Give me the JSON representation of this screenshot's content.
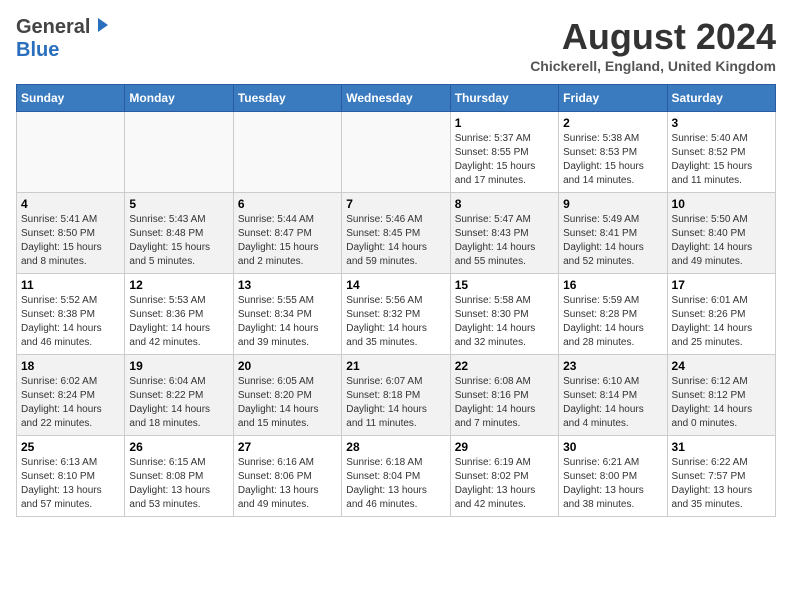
{
  "header": {
    "logo_general": "General",
    "logo_blue": "Blue",
    "month_year": "August 2024",
    "location": "Chickerell, England, United Kingdom"
  },
  "weekdays": [
    "Sunday",
    "Monday",
    "Tuesday",
    "Wednesday",
    "Thursday",
    "Friday",
    "Saturday"
  ],
  "weeks": [
    [
      {
        "day": "",
        "info": ""
      },
      {
        "day": "",
        "info": ""
      },
      {
        "day": "",
        "info": ""
      },
      {
        "day": "",
        "info": ""
      },
      {
        "day": "1",
        "info": "Sunrise: 5:37 AM\nSunset: 8:55 PM\nDaylight: 15 hours\nand 17 minutes."
      },
      {
        "day": "2",
        "info": "Sunrise: 5:38 AM\nSunset: 8:53 PM\nDaylight: 15 hours\nand 14 minutes."
      },
      {
        "day": "3",
        "info": "Sunrise: 5:40 AM\nSunset: 8:52 PM\nDaylight: 15 hours\nand 11 minutes."
      }
    ],
    [
      {
        "day": "4",
        "info": "Sunrise: 5:41 AM\nSunset: 8:50 PM\nDaylight: 15 hours\nand 8 minutes."
      },
      {
        "day": "5",
        "info": "Sunrise: 5:43 AM\nSunset: 8:48 PM\nDaylight: 15 hours\nand 5 minutes."
      },
      {
        "day": "6",
        "info": "Sunrise: 5:44 AM\nSunset: 8:47 PM\nDaylight: 15 hours\nand 2 minutes."
      },
      {
        "day": "7",
        "info": "Sunrise: 5:46 AM\nSunset: 8:45 PM\nDaylight: 14 hours\nand 59 minutes."
      },
      {
        "day": "8",
        "info": "Sunrise: 5:47 AM\nSunset: 8:43 PM\nDaylight: 14 hours\nand 55 minutes."
      },
      {
        "day": "9",
        "info": "Sunrise: 5:49 AM\nSunset: 8:41 PM\nDaylight: 14 hours\nand 52 minutes."
      },
      {
        "day": "10",
        "info": "Sunrise: 5:50 AM\nSunset: 8:40 PM\nDaylight: 14 hours\nand 49 minutes."
      }
    ],
    [
      {
        "day": "11",
        "info": "Sunrise: 5:52 AM\nSunset: 8:38 PM\nDaylight: 14 hours\nand 46 minutes."
      },
      {
        "day": "12",
        "info": "Sunrise: 5:53 AM\nSunset: 8:36 PM\nDaylight: 14 hours\nand 42 minutes."
      },
      {
        "day": "13",
        "info": "Sunrise: 5:55 AM\nSunset: 8:34 PM\nDaylight: 14 hours\nand 39 minutes."
      },
      {
        "day": "14",
        "info": "Sunrise: 5:56 AM\nSunset: 8:32 PM\nDaylight: 14 hours\nand 35 minutes."
      },
      {
        "day": "15",
        "info": "Sunrise: 5:58 AM\nSunset: 8:30 PM\nDaylight: 14 hours\nand 32 minutes."
      },
      {
        "day": "16",
        "info": "Sunrise: 5:59 AM\nSunset: 8:28 PM\nDaylight: 14 hours\nand 28 minutes."
      },
      {
        "day": "17",
        "info": "Sunrise: 6:01 AM\nSunset: 8:26 PM\nDaylight: 14 hours\nand 25 minutes."
      }
    ],
    [
      {
        "day": "18",
        "info": "Sunrise: 6:02 AM\nSunset: 8:24 PM\nDaylight: 14 hours\nand 22 minutes."
      },
      {
        "day": "19",
        "info": "Sunrise: 6:04 AM\nSunset: 8:22 PM\nDaylight: 14 hours\nand 18 minutes."
      },
      {
        "day": "20",
        "info": "Sunrise: 6:05 AM\nSunset: 8:20 PM\nDaylight: 14 hours\nand 15 minutes."
      },
      {
        "day": "21",
        "info": "Sunrise: 6:07 AM\nSunset: 8:18 PM\nDaylight: 14 hours\nand 11 minutes."
      },
      {
        "day": "22",
        "info": "Sunrise: 6:08 AM\nSunset: 8:16 PM\nDaylight: 14 hours\nand 7 minutes."
      },
      {
        "day": "23",
        "info": "Sunrise: 6:10 AM\nSunset: 8:14 PM\nDaylight: 14 hours\nand 4 minutes."
      },
      {
        "day": "24",
        "info": "Sunrise: 6:12 AM\nSunset: 8:12 PM\nDaylight: 14 hours\nand 0 minutes."
      }
    ],
    [
      {
        "day": "25",
        "info": "Sunrise: 6:13 AM\nSunset: 8:10 PM\nDaylight: 13 hours\nand 57 minutes."
      },
      {
        "day": "26",
        "info": "Sunrise: 6:15 AM\nSunset: 8:08 PM\nDaylight: 13 hours\nand 53 minutes."
      },
      {
        "day": "27",
        "info": "Sunrise: 6:16 AM\nSunset: 8:06 PM\nDaylight: 13 hours\nand 49 minutes."
      },
      {
        "day": "28",
        "info": "Sunrise: 6:18 AM\nSunset: 8:04 PM\nDaylight: 13 hours\nand 46 minutes."
      },
      {
        "day": "29",
        "info": "Sunrise: 6:19 AM\nSunset: 8:02 PM\nDaylight: 13 hours\nand 42 minutes."
      },
      {
        "day": "30",
        "info": "Sunrise: 6:21 AM\nSunset: 8:00 PM\nDaylight: 13 hours\nand 38 minutes."
      },
      {
        "day": "31",
        "info": "Sunrise: 6:22 AM\nSunset: 7:57 PM\nDaylight: 13 hours\nand 35 minutes."
      }
    ]
  ]
}
